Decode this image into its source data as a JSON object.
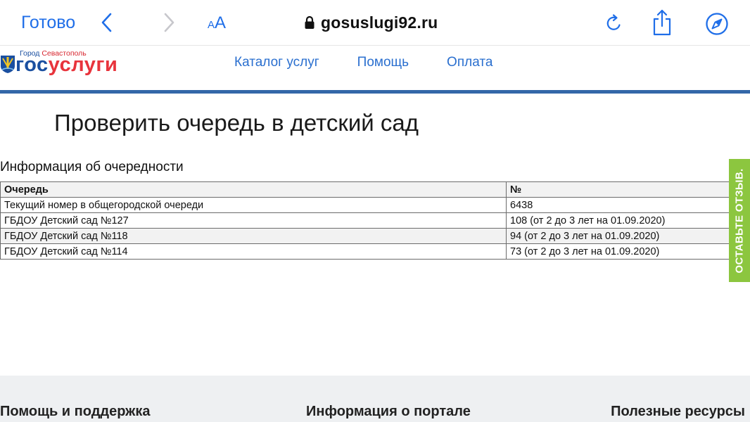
{
  "browser": {
    "done_label": "Готово",
    "text_size_small": "A",
    "text_size_big": "A",
    "url": "gosuslugi92.ru",
    "accent_color": "#1f6ee8"
  },
  "site": {
    "logo_city_prefix": "Город",
    "logo_city_name": "Севастополь",
    "logo_word_part1": "гос",
    "logo_word_part2": "услуги",
    "nav": [
      "Каталог услуг",
      "Помощь",
      "Оплата"
    ]
  },
  "main": {
    "title": "Проверить очередь в детский сад",
    "caption": "Информация об очередности",
    "table": {
      "headers": [
        "Очередь",
        "№"
      ],
      "rows": [
        [
          "Текущий номер в общегородской очереди",
          "6438"
        ],
        [
          "ГБДОУ Детский сад №127",
          "108 (от 2 до 3 лет на 01.09.2020)"
        ],
        [
          "ГБДОУ Детский сад №118",
          "94 (от 2 до 3 лет на 01.09.2020)"
        ],
        [
          "ГБДОУ Детский сад №114",
          "73 (от 2 до 3 лет на 01.09.2020)"
        ]
      ]
    }
  },
  "feedback": {
    "label": "ОСТАВЬТЕ ОТЗЫВ.",
    "color": "#8cc63f"
  },
  "footer": {
    "columns": [
      "Помощь и поддержка",
      "Информация о портале",
      "Полезные ресурсы"
    ]
  },
  "icons": {
    "back": "chevron-left-icon",
    "forward": "chevron-right-icon",
    "lock": "lock-icon",
    "reload": "reload-icon",
    "share": "share-icon",
    "compass": "compass-icon"
  }
}
